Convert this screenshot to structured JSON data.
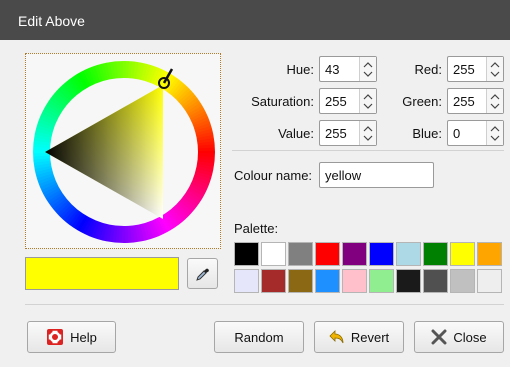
{
  "window": {
    "title": "Edit Above"
  },
  "wheel": {
    "hue": 43,
    "selected_color": "#ffff00"
  },
  "fields": {
    "hue": {
      "label": "Hue:",
      "value": "43"
    },
    "saturation": {
      "label": "Saturation:",
      "value": "255"
    },
    "value": {
      "label": "Value:",
      "value": "255"
    },
    "red": {
      "label": "Red:",
      "value": "255"
    },
    "green": {
      "label": "Green:",
      "value": "255"
    },
    "blue": {
      "label": "Blue:",
      "value": "0"
    },
    "colour_name": {
      "label": "Colour name:",
      "value": "yellow"
    }
  },
  "palette": {
    "label": "Palette:",
    "colors": [
      "#000000",
      "#ffffff",
      "#808080",
      "#ff0000",
      "#800080",
      "#0000ff",
      "#add8e6",
      "#008000",
      "#ffff00",
      "#ffa500",
      "#e6e6fa",
      "#a52a2a",
      "#8b6914",
      "#1e90ff",
      "#ffc0cb",
      "#90ee90",
      "#1a1a1a",
      "#505050",
      "#c0c0c0",
      "#eeeeee"
    ]
  },
  "preview": {
    "color": "#ffff00"
  },
  "buttons": {
    "help": "Help",
    "random": "Random",
    "revert": "Revert",
    "close": "Close",
    "icons": {
      "help": "lifebuoy-icon",
      "revert": "undo-arrow-icon",
      "close": "x-icon",
      "picker": "eyedropper-icon"
    }
  }
}
